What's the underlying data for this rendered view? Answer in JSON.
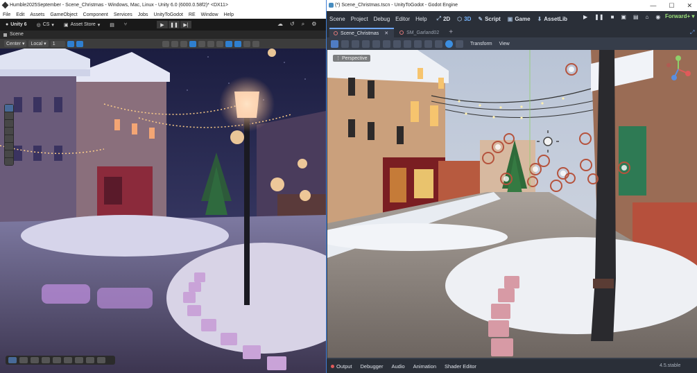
{
  "unity": {
    "window_title": "Humble2025September - Scene_Christmas - Windows, Mac, Linux - Unity 6.0 (6000.0.58f2)* <DX11>",
    "menu": [
      "File",
      "Edit",
      "Assets",
      "GameObject",
      "Component",
      "Services",
      "Jobs",
      "UnityToGodot",
      "RE",
      "Window",
      "Help"
    ],
    "account": "Unity 6",
    "cs_label": "CS",
    "asset_store": "Asset Store",
    "scene_tab": "Scene",
    "pivot": "Center",
    "space": "Local",
    "snap_value": "1"
  },
  "godot": {
    "window_title": "(*) Scene_Christmas.tscn - UnityToGodot - Godot Engine",
    "window_controls": [
      "—",
      "☐",
      "✕"
    ],
    "menu": [
      "Scene",
      "Project",
      "Debug",
      "Editor",
      "Help"
    ],
    "workspaces": [
      {
        "icon": "⤢",
        "label": "2D"
      },
      {
        "icon": "⬡",
        "label": "3D"
      },
      {
        "icon": "✎",
        "label": "Script"
      },
      {
        "icon": "▣",
        "label": "Game"
      },
      {
        "icon": "⬇",
        "label": "AssetLib"
      }
    ],
    "active_workspace": "3D",
    "run_controls": [
      "▶",
      "❚❚",
      "■",
      "▣",
      "▤",
      "⌂",
      "◉"
    ],
    "renderer": "Forward+",
    "tabs": [
      {
        "label": "Scene_Christmas",
        "active": true
      },
      {
        "label": "SM_Garland02",
        "active": false
      }
    ],
    "toolbar_menus": [
      "Transform",
      "View"
    ],
    "viewport_label": "Perspective",
    "bottom_tabs": [
      "Output",
      "Debugger",
      "Audio",
      "Animation",
      "Shader Editor"
    ],
    "version": "4.5.stable"
  }
}
